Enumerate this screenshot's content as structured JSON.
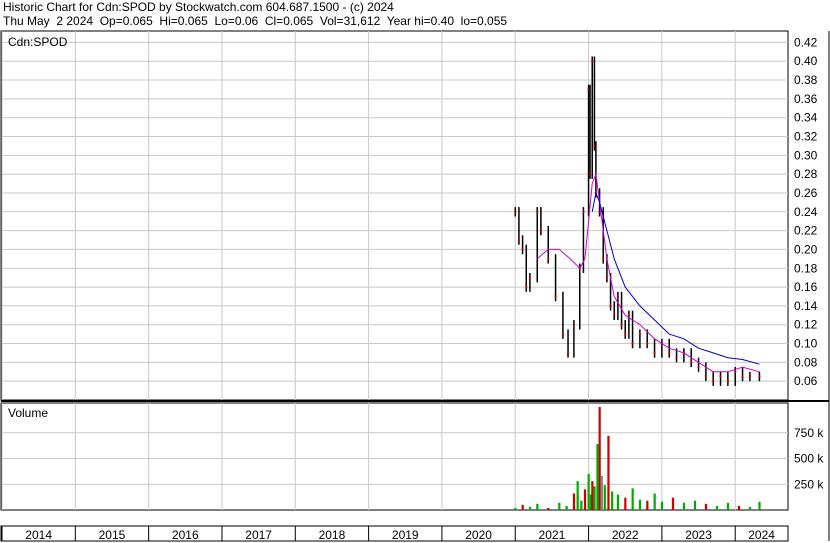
{
  "header": {
    "line1": "Historic Chart for Cdn:SPOD by Stockwatch.com 604.687.1500 - (c) 2024",
    "line2": "Thu May  2 2024  Op=0.065  Hi=0.065  Lo=0.06  Cl=0.065  Vol=31,612  Year hi=0.40  lo=0.055"
  },
  "colors": {
    "background": "#ffffff",
    "grid": "#c8c8c8",
    "price_bar": "#000000",
    "price_dot": "#cc0000",
    "ma_short": "#cc00cc",
    "ma_long": "#0000cc",
    "vol_up": "#00aa00",
    "vol_down": "#cc0000",
    "vol_flat": "#888888"
  },
  "chart_data": [
    {
      "type": "line",
      "title": "Cdn:SPOD",
      "ylabel": "",
      "xlabel": "",
      "ylim": [
        0.04,
        0.43
      ],
      "y_ticks": [
        "0.42",
        "0.40",
        "0.38",
        "0.36",
        "0.34",
        "0.32",
        "0.30",
        "0.28",
        "0.26",
        "0.24",
        "0.22",
        "0.20",
        "0.18",
        "0.16",
        "0.14",
        "0.12",
        "0.10",
        "0.08",
        "0.06"
      ],
      "x_categories": [
        "2014",
        "2015",
        "2016",
        "2017",
        "2018",
        "2019",
        "2020",
        "2021",
        "2022",
        "2023",
        "2024"
      ],
      "series": [
        {
          "values_xy": [
            [
              2021.0,
              0.24
            ],
            [
              2021.05,
              0.21
            ],
            [
              2021.1,
              0.2
            ],
            [
              2021.15,
              0.16
            ],
            [
              2021.2,
              0.17
            ],
            [
              2021.3,
              0.24
            ],
            [
              2021.35,
              0.22
            ],
            [
              2021.45,
              0.19
            ],
            [
              2021.55,
              0.15
            ],
            [
              2021.65,
              0.11
            ],
            [
              2021.72,
              0.09
            ],
            [
              2021.8,
              0.12
            ],
            [
              2021.88,
              0.18
            ],
            [
              2021.93,
              0.24
            ],
            [
              2022.0,
              0.37
            ],
            [
              2022.02,
              0.28
            ],
            [
              2022.05,
              0.4
            ],
            [
              2022.08,
              0.31
            ],
            [
              2022.1,
              0.26
            ],
            [
              2022.15,
              0.24
            ],
            [
              2022.2,
              0.19
            ],
            [
              2022.25,
              0.17
            ],
            [
              2022.3,
              0.14
            ],
            [
              2022.35,
              0.13
            ],
            [
              2022.4,
              0.15
            ],
            [
              2022.45,
              0.12
            ],
            [
              2022.5,
              0.11
            ],
            [
              2022.55,
              0.13
            ],
            [
              2022.6,
              0.1
            ],
            [
              2022.7,
              0.11
            ],
            [
              2022.8,
              0.1
            ],
            [
              2022.9,
              0.09
            ],
            [
              2023.0,
              0.1
            ],
            [
              2023.1,
              0.09
            ],
            [
              2023.2,
              0.085
            ],
            [
              2023.3,
              0.09
            ],
            [
              2023.4,
              0.08
            ],
            [
              2023.5,
              0.075
            ],
            [
              2023.6,
              0.065
            ],
            [
              2023.7,
              0.06
            ],
            [
              2023.8,
              0.065
            ],
            [
              2023.9,
              0.06
            ],
            [
              2024.0,
              0.07
            ],
            [
              2024.1,
              0.065
            ],
            [
              2024.2,
              0.065
            ],
            [
              2024.33,
              0.065
            ]
          ]
        },
        {
          "values_xy": [
            [
              2021.3,
              0.19
            ],
            [
              2021.45,
              0.2
            ],
            [
              2021.6,
              0.2
            ],
            [
              2021.75,
              0.19
            ],
            [
              2021.88,
              0.18
            ],
            [
              2021.95,
              0.19
            ],
            [
              2022.0,
              0.23
            ],
            [
              2022.05,
              0.27
            ],
            [
              2022.1,
              0.28
            ],
            [
              2022.15,
              0.25
            ],
            [
              2022.25,
              0.19
            ],
            [
              2022.35,
              0.15
            ],
            [
              2022.5,
              0.13
            ],
            [
              2022.7,
              0.12
            ],
            [
              2022.9,
              0.105
            ],
            [
              2023.1,
              0.095
            ],
            [
              2023.3,
              0.09
            ],
            [
              2023.5,
              0.08
            ],
            [
              2023.7,
              0.07
            ],
            [
              2023.9,
              0.07
            ],
            [
              2024.1,
              0.075
            ],
            [
              2024.33,
              0.07
            ]
          ]
        },
        {
          "values_xy": [
            [
              2022.05,
              0.24
            ],
            [
              2022.1,
              0.26
            ],
            [
              2022.15,
              0.25
            ],
            [
              2022.25,
              0.22
            ],
            [
              2022.35,
              0.19
            ],
            [
              2022.5,
              0.16
            ],
            [
              2022.7,
              0.14
            ],
            [
              2022.9,
              0.125
            ],
            [
              2023.1,
              0.11
            ],
            [
              2023.3,
              0.105
            ],
            [
              2023.5,
              0.095
            ],
            [
              2023.7,
              0.09
            ],
            [
              2023.9,
              0.085
            ],
            [
              2024.1,
              0.083
            ],
            [
              2024.33,
              0.078
            ]
          ]
        }
      ]
    },
    {
      "type": "bar",
      "title": "Volume",
      "ylim": [
        0,
        1000000
      ],
      "y_ticks": [
        "750 k",
        "500 k",
        "250 k"
      ],
      "series": [
        {
          "values_xy": [
            [
              2021.0,
              20000
            ],
            [
              2021.1,
              50000
            ],
            [
              2021.2,
              30000
            ],
            [
              2021.3,
              60000
            ],
            [
              2021.45,
              20000
            ],
            [
              2021.6,
              70000
            ],
            [
              2021.7,
              40000
            ],
            [
              2021.8,
              160000
            ],
            [
              2021.85,
              280000
            ],
            [
              2021.9,
              90000
            ],
            [
              2021.95,
              200000
            ],
            [
              2022.0,
              350000
            ],
            [
              2022.03,
              150000
            ],
            [
              2022.05,
              280000
            ],
            [
              2022.08,
              230000
            ],
            [
              2022.12,
              640000
            ],
            [
              2022.15,
              1000000
            ],
            [
              2022.18,
              330000
            ],
            [
              2022.22,
              240000
            ],
            [
              2022.27,
              720000
            ],
            [
              2022.32,
              180000
            ],
            [
              2022.4,
              150000
            ],
            [
              2022.5,
              120000
            ],
            [
              2022.6,
              210000
            ],
            [
              2022.7,
              100000
            ],
            [
              2022.8,
              90000
            ],
            [
              2022.9,
              160000
            ],
            [
              2023.0,
              80000
            ],
            [
              2023.15,
              120000
            ],
            [
              2023.3,
              70000
            ],
            [
              2023.45,
              90000
            ],
            [
              2023.6,
              60000
            ],
            [
              2023.75,
              40000
            ],
            [
              2023.9,
              70000
            ],
            [
              2024.05,
              40000
            ],
            [
              2024.2,
              30000
            ],
            [
              2024.33,
              80000
            ]
          ]
        }
      ]
    }
  ]
}
